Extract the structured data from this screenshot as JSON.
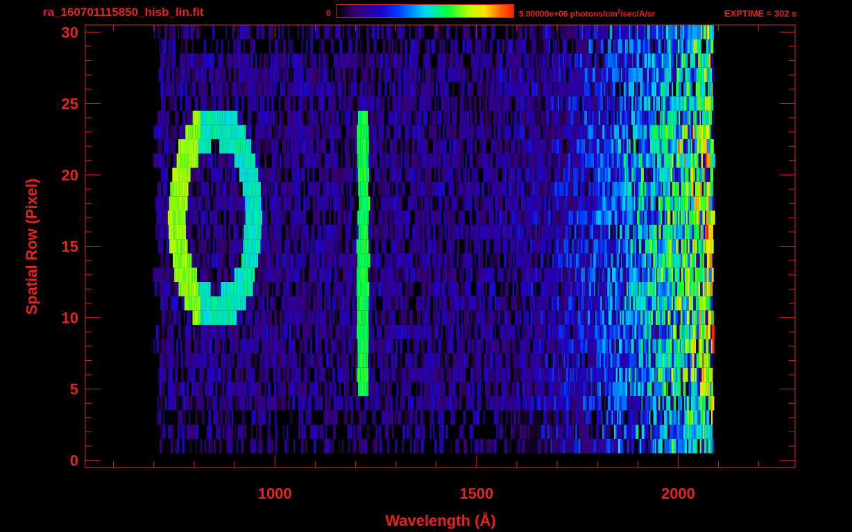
{
  "header": {
    "file_title": "ra_160701115850_hisb_lin.fit",
    "colorbar_min": "0",
    "colorbar_max": "5.00000e+06 photons/cm",
    "colorbar_max_sup": "2",
    "colorbar_max_suffix": "/sec/A/sr",
    "exptime": "EXPTIME = 302 s"
  },
  "colors": {
    "axis": "#e8231e",
    "background": "#000000"
  },
  "chart_data": {
    "type": "heatmap",
    "title": "",
    "xlabel": "Wavelength (Å)",
    "ylabel": "Spatial Row (Pixel)",
    "xlim": [
      530,
      2290
    ],
    "ylim": [
      -0.5,
      30.5
    ],
    "xticks": [
      1000,
      1500,
      2000
    ],
    "yticks": [
      0,
      5,
      10,
      15,
      20,
      25,
      30
    ],
    "colorscale": "rainbow",
    "value_range": [
      0,
      5000000
    ],
    "features": [
      {
        "name": "",
        "kind": "ring",
        "center_x": 850,
        "center_y": 17,
        "x_radius": 95,
        "y_radius": 6.5
      },
      {
        "name": "",
        "kind": "vertical-line",
        "x": 1216,
        "y_from": 5,
        "y_to": 24
      },
      {
        "name": "",
        "kind": "continuum",
        "x_from": 1700,
        "x_to": 2065,
        "y_from": 5,
        "y_to": 23
      }
    ]
  }
}
